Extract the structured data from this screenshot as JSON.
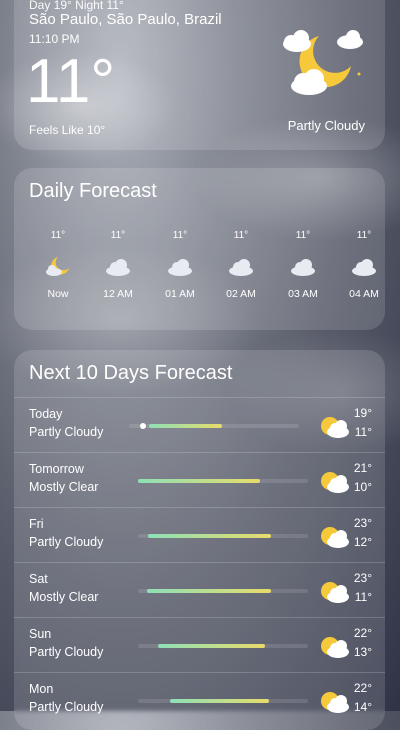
{
  "current": {
    "date_line": "Day 19° Night 11°",
    "location": "São Paulo, São Paulo, Brazil",
    "time": "11:10 PM",
    "temperature": "11°",
    "feels_like": "Feels Like 10°",
    "condition": "Partly Cloudy",
    "icon": "moon-cloud-icon"
  },
  "daily": {
    "title": "Daily Forecast",
    "hours": [
      {
        "temp": "11°",
        "label": "Now",
        "icon": "moon-cloud-icon"
      },
      {
        "temp": "11°",
        "label": "12 AM",
        "icon": "cloud-icon"
      },
      {
        "temp": "11°",
        "label": "01 AM",
        "icon": "cloud-icon"
      },
      {
        "temp": "11°",
        "label": "02 AM",
        "icon": "cloud-icon"
      },
      {
        "temp": "11°",
        "label": "03 AM",
        "icon": "cloud-icon"
      },
      {
        "temp": "11°",
        "label": "04 AM",
        "icon": "cloud-icon"
      }
    ]
  },
  "ten_day": {
    "title": "Next 10 Days Forecast",
    "days": [
      {
        "name": "Today",
        "condition": "Partly Cloudy",
        "high": "19°",
        "low": "11°",
        "bar_start": 0.12,
        "bar_end": 0.55,
        "dot": 0.05,
        "icon": "sun-cloud-icon"
      },
      {
        "name": "Tomorrow",
        "condition": "Mostly Clear",
        "high": "21°",
        "low": "10°",
        "bar_start": 0.0,
        "bar_end": 0.72,
        "icon": "sun-cloud-icon"
      },
      {
        "name": "Fri",
        "condition": "Partly Cloudy",
        "high": "23°",
        "low": "12°",
        "bar_start": 0.06,
        "bar_end": 0.78,
        "icon": "sun-cloud-icon"
      },
      {
        "name": "Sat",
        "condition": "Mostly Clear",
        "high": "23°",
        "low": "11°",
        "bar_start": 0.05,
        "bar_end": 0.78,
        "icon": "sun-cloud-icon"
      },
      {
        "name": "Sun",
        "condition": "Partly Cloudy",
        "high": "22°",
        "low": "13°",
        "bar_start": 0.12,
        "bar_end": 0.75,
        "icon": "sun-cloud-icon"
      },
      {
        "name": "Mon",
        "condition": "Partly Cloudy",
        "high": "22°",
        "low": "14°",
        "bar_start": 0.19,
        "bar_end": 0.77,
        "icon": "sun-cloud-icon"
      }
    ]
  }
}
